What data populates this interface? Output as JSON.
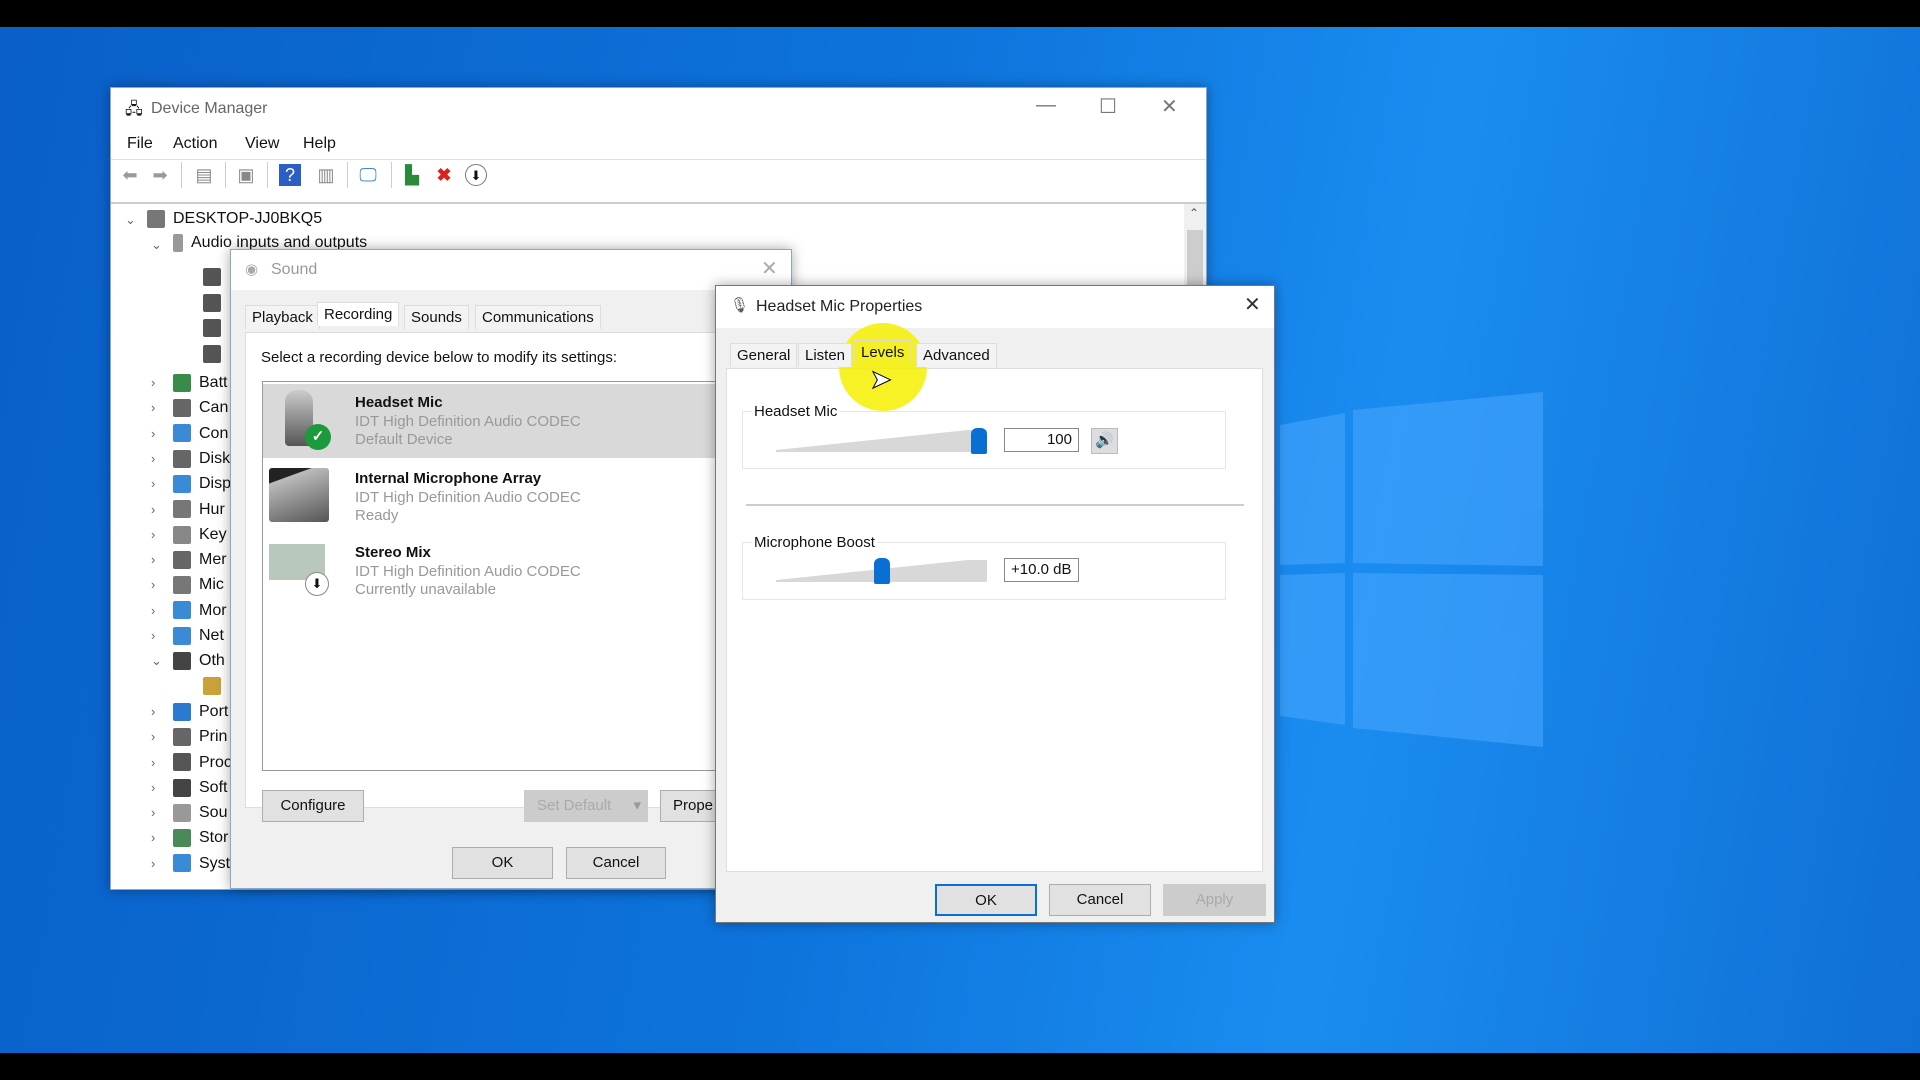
{
  "device_manager": {
    "title": "Device Manager",
    "menu": [
      "File",
      "Action",
      "View",
      "Help"
    ],
    "computer": "DESKTOP-JJ0BKQ5",
    "audio": "Audio inputs and outputs",
    "categories": [
      "Batt",
      "Can",
      "Con",
      "Disk",
      "Disp",
      "Hur",
      "Key",
      "Mer",
      "Mic",
      "Mor",
      "Net",
      "Oth",
      "",
      "Port",
      "Prin",
      "Proc",
      "Soft",
      "Sou",
      "Stor",
      "Syst"
    ]
  },
  "sound": {
    "title": "Sound",
    "tabs": [
      "Playback",
      "Recording",
      "Sounds",
      "Communications"
    ],
    "active_tab": "Recording",
    "instruction": "Select a recording device below to modify its settings:",
    "devices": [
      {
        "name": "Headset Mic",
        "driver": "IDT High Definition Audio CODEC",
        "status": "Default Device"
      },
      {
        "name": "Internal Microphone Array",
        "driver": "IDT High Definition Audio CODEC",
        "status": "Ready"
      },
      {
        "name": "Stereo Mix",
        "driver": "IDT High Definition Audio CODEC",
        "status": "Currently unavailable"
      }
    ],
    "configure": "Configure",
    "set_default": "Set Default",
    "properties": "Prope",
    "ok": "OK",
    "cancel": "Cancel"
  },
  "props": {
    "title": "Headset Mic Properties",
    "tabs": [
      "General",
      "Listen",
      "Levels",
      "Advanced"
    ],
    "active_tab": "Levels",
    "level_label": "Headset Mic",
    "level_value": "100",
    "level_fraction": 1.0,
    "boost_label": "Microphone Boost",
    "boost_value": "+10.0 dB",
    "boost_fraction": 0.5,
    "ok": "OK",
    "cancel": "Cancel",
    "apply": "Apply"
  },
  "colors": {
    "accent": "#0a6fd3",
    "highlight": "#f5f000"
  }
}
